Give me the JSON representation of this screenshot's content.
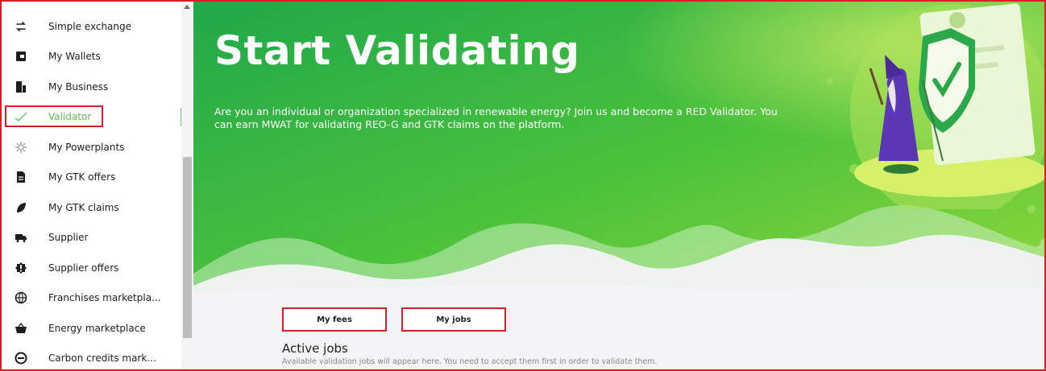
{
  "sidebar": {
    "items": [
      {
        "label": "Simple exchange",
        "icon": "exchange-icon"
      },
      {
        "label": "My Wallets",
        "icon": "wallet-icon"
      },
      {
        "label": "My Business",
        "icon": "building-icon"
      },
      {
        "label": "Validator",
        "icon": "check-icon",
        "active": true
      },
      {
        "label": "My Powerplants",
        "icon": "sun-icon"
      },
      {
        "label": "My GTK offers",
        "icon": "document-icon"
      },
      {
        "label": "My GTK claims",
        "icon": "leaf-icon"
      },
      {
        "label": "Supplier",
        "icon": "truck-icon"
      },
      {
        "label": "Supplier offers",
        "icon": "badge-icon"
      },
      {
        "label": "Franchises marketpla...",
        "icon": "globe-icon"
      },
      {
        "label": "Energy marketplace",
        "icon": "basket-icon"
      },
      {
        "label": "Carbon credits mark...",
        "icon": "carbon-icon"
      }
    ]
  },
  "hero": {
    "title": "Start Validating",
    "description": "Are you an individual or organization specialized in renewable energy? Join us and become a RED Validator. You can earn MWAT for validating REO-G and GTK claims on the platform."
  },
  "buttons": {
    "fees": "My fees",
    "jobs": "My jobs"
  },
  "active_jobs": {
    "title": "Active jobs",
    "subtitle": "Available validation jobs will appear here. You need to accept them first in order to validate them."
  },
  "colors": {
    "accent_green": "#6cc86c",
    "hero_green": "#3fbf3f",
    "highlight_red": "#d61f26"
  }
}
